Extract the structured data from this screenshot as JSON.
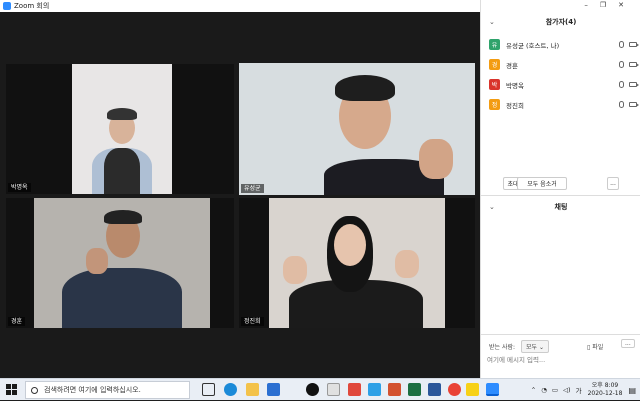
{
  "window": {
    "title": "Zoom 회의"
  },
  "tiles": [
    {
      "name": "박명옥",
      "active": false
    },
    {
      "name": "유성균",
      "active": true
    },
    {
      "name": "경훈",
      "active": false
    },
    {
      "name": "정진희",
      "active": false
    }
  ],
  "participants_panel": {
    "title": "참가자(4)",
    "participants": [
      {
        "initial": "유",
        "name": "유성균 (호스트, 나)",
        "color": "#2fa36b"
      },
      {
        "initial": "경",
        "name": "경훈",
        "color": "#f39c12"
      },
      {
        "initial": "박",
        "name": "박명옥",
        "color": "#d9342b"
      },
      {
        "initial": "정",
        "name": "정진희",
        "color": "#f39c12"
      }
    ],
    "invite_label": "초대",
    "mute_all_label": "모두 음소거",
    "more_label": "..."
  },
  "chat_panel": {
    "title": "채팅",
    "to_label": "받는 사람:",
    "to_value": "모두",
    "file_label": "파일",
    "more_label": "...",
    "placeholder": "여기에 메시지 입력..."
  },
  "taskbar": {
    "search_placeholder": "검색하려면 여기에 입력하십시오.",
    "ime_label": "가",
    "time": "오후 8:09",
    "date": "2020-12-18"
  }
}
